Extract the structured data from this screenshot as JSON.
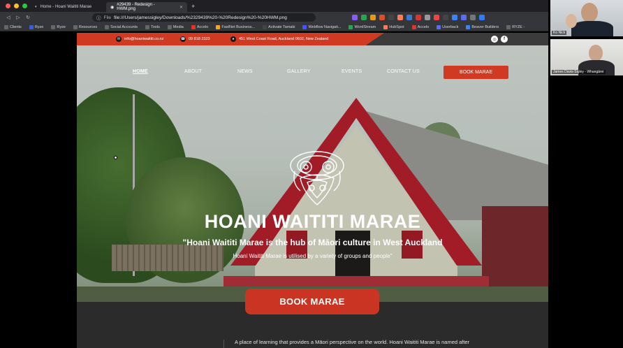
{
  "browser": {
    "tabs": [
      {
        "label": "Home - Hoani Waititi Marae",
        "active": false
      },
      {
        "label": "#29439 - Redesign - HWM.png",
        "active": true
      }
    ],
    "url_scheme": "File",
    "url": "file:///Users/jamessigley/Downloads/%2329439%20-%20Redesign%20-%20HWM.png",
    "bookmarks": [
      "Clients",
      "Ryze",
      "Ryze",
      "Resources",
      "Social Accounts",
      "Tools",
      "Media",
      "Accelo",
      "FastNet Business...",
      "Activate Tamaki",
      "Webflow Navigati...",
      "WordStream",
      "HubSpot",
      "Accelo",
      "Userback",
      "Beaver Builders",
      "RYZE -"
    ],
    "extension_badge": "8"
  },
  "topbar": {
    "email": "info@hoaniwaititi.co.nz",
    "phone": "09 818 2323",
    "address": "451 West Coast Road, Auckland 0602, New Zealand"
  },
  "nav": {
    "items": [
      "HOME",
      "ABOUT",
      "NEWS",
      "GALLERY",
      "EVENTS",
      "CONTACT US"
    ],
    "book_label": "BOOK MARAE"
  },
  "hero": {
    "title": "HOANI WAITITI MARAE",
    "tagline": "\"Hoani Waititi Marae is the hub of Māori culture in West Auckland",
    "subtitle": "Hoani Waititi Marae is utilised by a variety of groups and people\"",
    "book_label": "BOOK MARAE"
  },
  "intro": {
    "text": "A place of learning that provides a Māori perspective on the world. Hoani Waititi Marae is named after"
  },
  "video": {
    "participants": [
      {
        "name": "Ko Nick"
      },
      {
        "name": "James Davis-Sigley - Whangārei"
      }
    ]
  },
  "colors": {
    "brand_red": "#d03a22",
    "chrome_dark": "#35363a"
  }
}
